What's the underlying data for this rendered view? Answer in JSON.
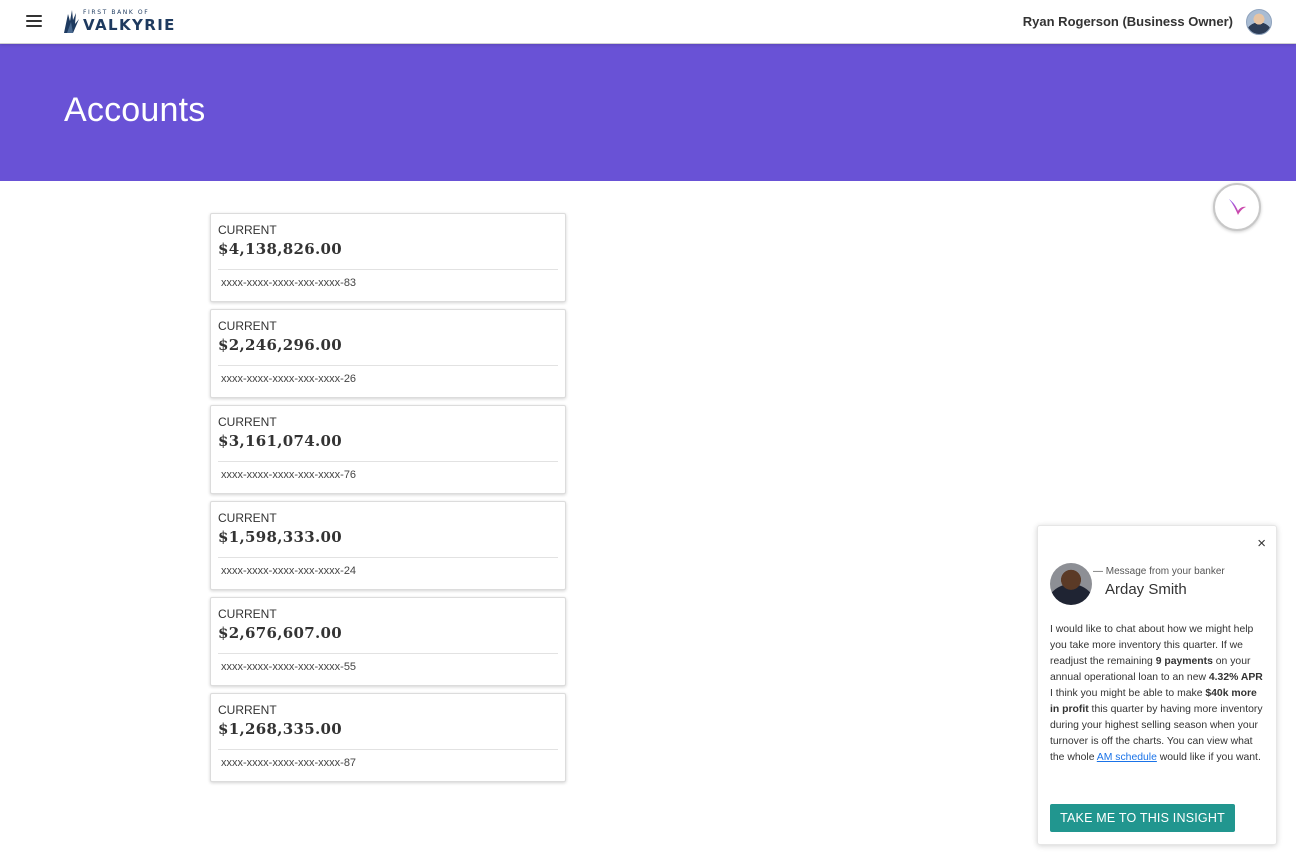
{
  "header": {
    "logo_top": "FIRST BANK OF",
    "logo_main": "VALKYRIE",
    "user_name": "Ryan Rogerson (Business Owner)"
  },
  "page": {
    "title": "Accounts"
  },
  "accounts": [
    {
      "type": "CURRENT",
      "balance": "$4,138,826.00",
      "number": "xxxx-xxxx-xxxx-xxx-xxxx-83"
    },
    {
      "type": "CURRENT",
      "balance": "$2,246,296.00",
      "number": "xxxx-xxxx-xxxx-xxx-xxxx-26"
    },
    {
      "type": "CURRENT",
      "balance": "$3,161,074.00",
      "number": "xxxx-xxxx-xxxx-xxx-xxxx-76"
    },
    {
      "type": "CURRENT",
      "balance": "$1,598,333.00",
      "number": "xxxx-xxxx-xxxx-xxx-xxxx-24"
    },
    {
      "type": "CURRENT",
      "balance": "$2,676,607.00",
      "number": "xxxx-xxxx-xxxx-xxx-xxxx-55"
    },
    {
      "type": "CURRENT",
      "balance": "$1,268,335.00",
      "number": "xxxx-xxxx-xxxx-xxx-xxxx-87"
    }
  ],
  "message": {
    "from_label": "— Message from your banker",
    "banker_name": "Arday Smith",
    "close_symbol": "×",
    "body_1": "I would like to chat about how we might help you take more inventory this quarter. If we readjust the remaining ",
    "bold_1": "9 payments",
    "body_2": " on your annual operational loan to an new ",
    "bold_2": "4.32% APR",
    "body_3": " I think you might be able to make ",
    "bold_3": "$40k more in profit",
    "body_4": " this quarter by having more inventory during your highest selling season when your turnover is off the charts. You can view what the whole ",
    "link": "AM schedule",
    "body_5": " would like if you want.",
    "cta": "TAKE ME TO THIS INSIGHT"
  },
  "colors": {
    "banner": "#6952d6",
    "cta": "#21968f",
    "link": "#1a73e8",
    "logo": "#1e3a5f"
  },
  "icons": {
    "menu": "hamburger-menu-icon",
    "logo": "valkyrie-wing-logo",
    "assistant": "assistant-swoosh-icon",
    "close": "close-icon"
  }
}
